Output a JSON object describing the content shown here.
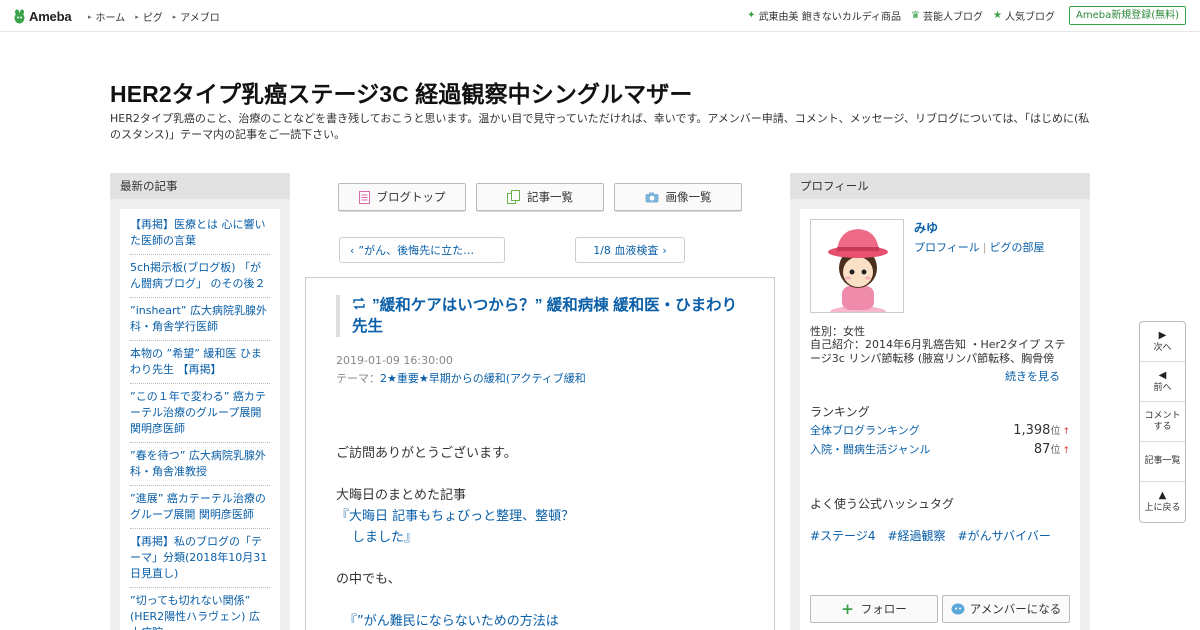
{
  "header": {
    "logo": "Ameba",
    "nav": [
      "ホーム",
      "ピグ",
      "アメブロ"
    ],
    "right_links": [
      {
        "icon": "sparkle-icon",
        "label": "武東由美 飽きないカルディ商品"
      },
      {
        "icon": "crown-icon",
        "label": "芸能人ブログ"
      },
      {
        "icon": "star-icon",
        "label": "人気ブログ"
      }
    ],
    "register": "Ameba新規登録(無料)",
    "accent": "#3aa14b"
  },
  "blog": {
    "title": "HER2タイプ乳癌ステージ3C 経過観察中シングルマザー",
    "description": "HER2タイプ乳癌のこと、治療のことなどを書き残しておこうと思います。温かい目で見守っていただければ、幸いです。アメンバー申請、コメント、メッセージ、リブログについては、「はじめに(私のスタンス)」テーマ内の記事をご一読下さい。"
  },
  "left": {
    "heading": "最新の記事",
    "items": [
      "【再掲】医療とは 心に響いた医師の言葉",
      "5ch掲示板(ブログ板) 「がん闘病ブログ」 のその後２",
      "”insheart” 広大病院乳腺外科・角舎学行医師",
      "本物の ”希望” 緩和医 ひまわり先生 【再掲】",
      "”この１年で変わる” 癌カテーテル治療のグループ展開 関明彦医師",
      "”春を待つ” 広大病院乳腺外科・角舎准教授",
      "”進展” 癌カテーテル治療のグループ展開 関明彦医師",
      "【再掲】私のブログの「テーマ」分類(2018年10月31日見直し)",
      "”切っても切れない関係” (HER2陽性ハラヴェン) 広大病院"
    ]
  },
  "center": {
    "buttons": [
      "ブログトップ",
      "記事一覧",
      "画像一覧"
    ],
    "prev": "”がん、後悔先に立た…",
    "next": "1/8 血液検査",
    "article": {
      "title": "”緩和ケアはいつから？” 緩和病棟 緩和医・ひまわり先生",
      "date": "2019-01-09 16:30:00",
      "theme_label": "テーマ：",
      "theme": "2★重要★早期からの緩和(アクティブ緩和",
      "greeting": "ご訪問ありがとうございます。",
      "summary_intro": "大晦日のまとめた記事",
      "summary_link_1": "『大晦日  記事もちょびっと整理、整頓？",
      "summary_link_2": "しました』",
      "among": "の中でも、",
      "link_2": "『”がん難民にならないための方法は"
    }
  },
  "right": {
    "heading": "プロフィール",
    "name": "みゆ",
    "profile_link": "プロフィール",
    "pig_link": "ピグの部屋",
    "gender": "性別：女性",
    "intro": "自己紹介：2014年6月乳癌告知 ・Her2タイプ ステージ3c リンパ節転移 (腋窩リンパ節転移、胸骨傍リ...",
    "more": "続きを見る",
    "ranking_heading": "ランキング",
    "rankings": [
      {
        "label": "全体ブログランキング",
        "value": "1,398",
        "unit": "位",
        "trend": "↑"
      },
      {
        "label": "入院・闘病生活ジャンル",
        "value": "87",
        "unit": "位",
        "trend": "↑"
      }
    ],
    "hashtag_heading": "よく使う公式ハッシュタグ",
    "hashtags": [
      "#ステージ4",
      "#経過観察",
      "#がんサバイバー"
    ],
    "follow": "フォロー",
    "member": "アメンバーになる"
  },
  "sidenav": {
    "next": "次へ",
    "prev": "前へ",
    "comment_1": "コメント",
    "comment_2": "する",
    "list": "記事一覧",
    "top": "上に戻る"
  }
}
